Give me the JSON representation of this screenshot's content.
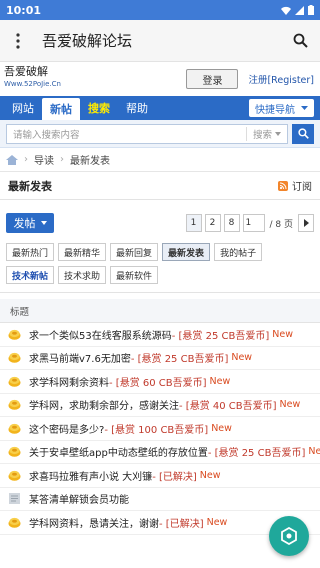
{
  "status": {
    "time": "10:01"
  },
  "app": {
    "title": "吾爱破解论坛"
  },
  "site": {
    "logo_text": "吾爱破解",
    "logo_sub": "Www.52PoJie.Cn",
    "login_label": "登录",
    "register_label": "注册[Register]"
  },
  "nav": {
    "items": [
      {
        "label": "网站"
      },
      {
        "label": "新帖"
      },
      {
        "label": "搜索"
      },
      {
        "label": "帮助"
      }
    ],
    "quick_nav_label": "快捷导航"
  },
  "search": {
    "placeholder": "请输入搜索内容",
    "type_label": "搜索"
  },
  "breadcrumb": {
    "items": [
      "导读",
      "最新发表"
    ]
  },
  "section": {
    "title": "最新发表",
    "rss_label": "订阅"
  },
  "toolbar": {
    "post_label": "发帖",
    "pages": [
      "1",
      "2",
      "8"
    ],
    "page_input": "1",
    "page_total": "/ 8 页"
  },
  "filters": [
    {
      "label": "最新热门"
    },
    {
      "label": "最新精华"
    },
    {
      "label": "最新回复"
    },
    {
      "label": "最新发表"
    },
    {
      "label": "我的帖子"
    },
    {
      "label": "技术新帖"
    },
    {
      "label": "技术求助"
    },
    {
      "label": "最新软件"
    }
  ],
  "list": {
    "header": "标题",
    "threads": [
      {
        "title": "求一个类似53在线客服系统源码",
        "reward": "- [悬赏 25 CB吾爱币]",
        "new": "New",
        "icon": "reward-icon"
      },
      {
        "title": "求黑马前端v7.6无加密",
        "reward": "- [悬赏 25 CB吾爱币]",
        "new": "New",
        "icon": "reward-icon"
      },
      {
        "title": "求学科网剩余资料",
        "reward": "- [悬赏 60 CB吾爱币]",
        "new": "New",
        "icon": "reward-icon"
      },
      {
        "title": "学科网，求助剩余部分，感谢关注",
        "reward": "- [悬赏 40 CB吾爱币]",
        "new": "New",
        "icon": "reward-icon"
      },
      {
        "title": "这个密码是多少?",
        "reward": "- [悬赏 100 CB吾爱币]",
        "new": "New",
        "icon": "reward-icon"
      },
      {
        "title": "关于安卓壁纸app中动态壁纸的存放位置",
        "reward": "- [悬赏 25 CB吾爱币]",
        "new": "New",
        "icon": "reward-icon"
      },
      {
        "title": "求喜玛拉雅有声小说 大刈镰",
        "reward": "- [已解决]",
        "new": "New",
        "icon": "reward-icon"
      },
      {
        "title": "某答清单解锁会员功能",
        "reward": "",
        "new": "",
        "icon": "document-icon"
      },
      {
        "title": "学科网资料，恳请关注，谢谢",
        "reward": "- [已解决]",
        "new": "New",
        "icon": "reward-icon"
      }
    ]
  }
}
